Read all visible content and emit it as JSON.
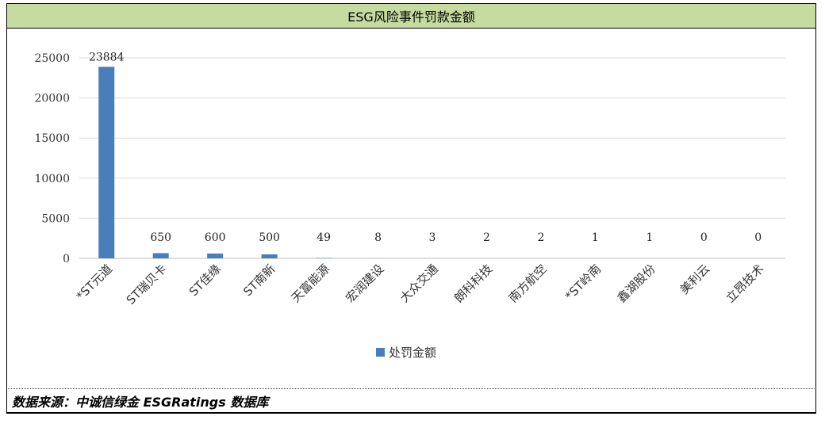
{
  "title": "ESG风险事件罚款金额",
  "source": "数据来源：中诚信绿金 ESGRatings 数据库",
  "colors": {
    "bar": "#4a7ebb",
    "title_bg": "#c5dba0",
    "grid": "#d9d9d9"
  },
  "chart_data": {
    "type": "bar",
    "categories": [
      "*ST元道",
      "ST瑞贝卡",
      "ST佳缘",
      "ST南新",
      "天富能源",
      "宏润建设",
      "大众交通",
      "朗科科技",
      "南方航空",
      "*ST岭南",
      "鑫湖股份",
      "美利云",
      "立昂技术"
    ],
    "series": [
      {
        "name": "处罚金额",
        "values": [
          23884,
          650,
          600,
          500,
          49,
          8,
          3,
          2,
          2,
          1,
          1,
          0,
          0
        ]
      }
    ],
    "yticks": [
      "0",
      "5000",
      "10000",
      "15000",
      "20000",
      "25000"
    ],
    "ylim": [
      0,
      25000
    ],
    "grid": true,
    "legend_position": "bottom"
  }
}
